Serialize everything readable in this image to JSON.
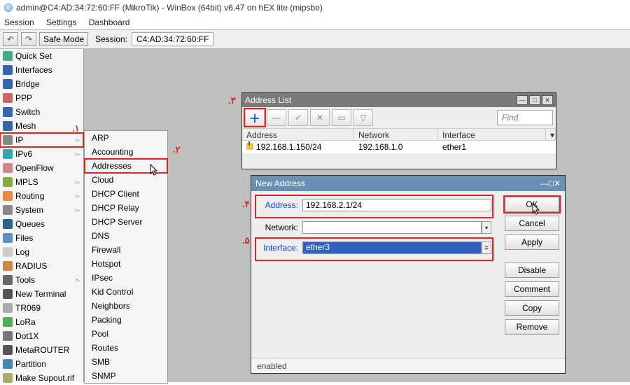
{
  "title": "admin@C4:AD:34:72:60:FF (MikroTik) - WinBox (64bit) v6.47 on hEX lite (mipsbe)",
  "menu": {
    "session": "Session",
    "settings": "Settings",
    "dashboard": "Dashboard"
  },
  "toolbar": {
    "back": "↶",
    "fwd": "↷",
    "safe": "Safe Mode",
    "session_label": "Session:",
    "session_value": "C4:AD:34:72:60:FF"
  },
  "sidebar": [
    {
      "label": "Quick Set",
      "expand": false,
      "icon": "#4a8"
    },
    {
      "label": "Interfaces",
      "expand": false,
      "icon": "#36a"
    },
    {
      "label": "Bridge",
      "expand": false,
      "icon": "#36a"
    },
    {
      "label": "PPP",
      "expand": false,
      "icon": "#c66"
    },
    {
      "label": "Switch",
      "expand": false,
      "icon": "#36a"
    },
    {
      "label": "Mesh",
      "expand": false,
      "icon": "#36a"
    },
    {
      "label": "IP",
      "expand": true,
      "icon": "#888",
      "hl": true
    },
    {
      "label": "IPv6",
      "expand": true,
      "icon": "#3aa"
    },
    {
      "label": "OpenFlow",
      "expand": false,
      "icon": "#c88"
    },
    {
      "label": "MPLS",
      "expand": true,
      "icon": "#8a4"
    },
    {
      "label": "Routing",
      "expand": true,
      "icon": "#e84"
    },
    {
      "label": "System",
      "expand": true,
      "icon": "#888"
    },
    {
      "label": "Queues",
      "expand": false,
      "icon": "#268"
    },
    {
      "label": "Files",
      "expand": false,
      "icon": "#5a8fc0"
    },
    {
      "label": "Log",
      "expand": false,
      "icon": "#ccc"
    },
    {
      "label": "RADIUS",
      "expand": false,
      "icon": "#c84"
    },
    {
      "label": "Tools",
      "expand": true,
      "icon": "#666"
    },
    {
      "label": "New Terminal",
      "expand": false,
      "icon": "#555"
    },
    {
      "label": "TR069",
      "expand": false,
      "icon": "#aaa"
    },
    {
      "label": "LoRa",
      "expand": false,
      "icon": "#5a5"
    },
    {
      "label": "Dot1X",
      "expand": false,
      "icon": "#777"
    },
    {
      "label": "MetaROUTER",
      "expand": false,
      "icon": "#555"
    },
    {
      "label": "Partition",
      "expand": false,
      "icon": "#48a"
    },
    {
      "label": "Make Supout.rif",
      "expand": false,
      "icon": "#aa6"
    }
  ],
  "submenu": [
    "ARP",
    "Accounting",
    "Addresses",
    "Cloud",
    "DHCP Client",
    "DHCP Relay",
    "DHCP Server",
    "DNS",
    "Firewall",
    "Hotspot",
    "IPsec",
    "Kid Control",
    "Neighbors",
    "Packing",
    "Pool",
    "Routes",
    "SMB",
    "SNMP"
  ],
  "submenu_hl_index": 2,
  "ann": {
    "a1": ".۱",
    "a2": ".۲",
    "a3": ".۳",
    "a4": ".۴",
    "a5": ".۵"
  },
  "addrlist": {
    "title": "Address List",
    "find": "Find",
    "headers": {
      "address": "Address",
      "network": "Network",
      "interface": "Interface"
    },
    "rows": [
      {
        "address": "192.168.1.150/24",
        "network": "192.168.1.0",
        "interface": "ether1"
      }
    ]
  },
  "newaddr": {
    "title": "New Address",
    "labels": {
      "address": "Address:",
      "network": "Network:",
      "interface": "Interface:"
    },
    "values": {
      "address": "192.168.2.1/24",
      "network": "",
      "interface": "ether3"
    },
    "buttons": {
      "ok": "OK",
      "cancel": "Cancel",
      "apply": "Apply",
      "disable": "Disable",
      "comment": "Comment",
      "copy": "Copy",
      "remove": "Remove"
    },
    "status": "enabled"
  }
}
